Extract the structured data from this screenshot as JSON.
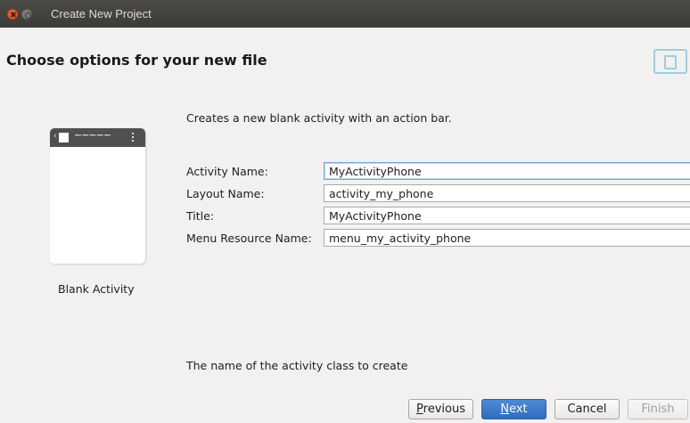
{
  "window": {
    "title": "Create New Project"
  },
  "header": {
    "heading": "Choose options for your new file"
  },
  "template": {
    "name": "Blank Activity"
  },
  "description": "Creates a new blank activity with an action bar.",
  "fields": [
    {
      "label": "Activity Name:",
      "value": "MyActivityPhone"
    },
    {
      "label": "Layout Name:",
      "value": "activity_my_phone"
    },
    {
      "label": "Title:",
      "value": "MyActivityPhone"
    },
    {
      "label": "Menu Resource Name:",
      "value": "menu_my_activity_phone"
    }
  ],
  "hint": "The name of the activity class to create",
  "buttons": {
    "previous_first": "P",
    "previous_rest": "revious",
    "next_first": "N",
    "next_rest": "ext",
    "cancel": "Cancel",
    "finish": "Finish"
  },
  "colors": {
    "primary_button": "#2f6cbe",
    "titlebar": "#3c3b37",
    "background": "#f2f1f0"
  }
}
